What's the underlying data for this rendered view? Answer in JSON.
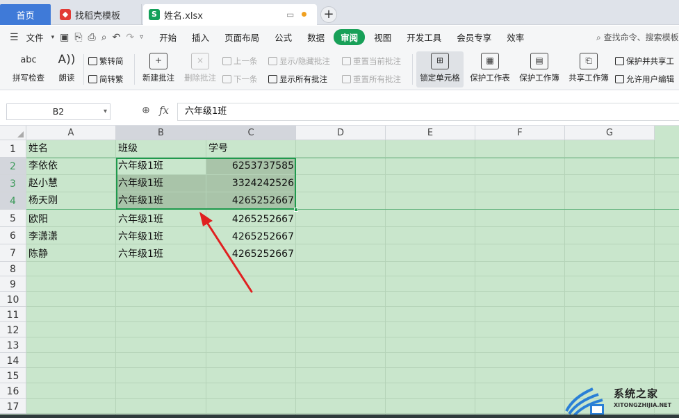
{
  "tabs": {
    "home": "首页",
    "template": "找稻壳模板",
    "file": "姓名.xlsx"
  },
  "menu": {
    "file_label": "文件",
    "items": [
      "开始",
      "插入",
      "页面布局",
      "公式",
      "数据",
      "审阅",
      "视图",
      "开发工具",
      "会员专享",
      "效率"
    ],
    "active": "审阅",
    "search_placeholder": "查找命令、搜索模板"
  },
  "ribbon": {
    "spell": "拼写检查",
    "read": "朗读",
    "trad": "繁转简",
    "simp": "简转繁",
    "new_comment": "新建批注",
    "delete_comment": "删除批注",
    "prev": "上一条",
    "next": "下一条",
    "show_hide": "显示/隐藏批注",
    "show_all": "显示所有批注",
    "reset_current": "重置当前批注",
    "reset_all": "重置所有批注",
    "lock_cell": "锁定单元格",
    "protect_sheet": "保护工作表",
    "protect_book": "保护工作簿",
    "share_book": "共享工作簿",
    "protect_share": "保护并共享工",
    "allow_edit": "允许用户编辑"
  },
  "formula": {
    "name_box": "B2",
    "fx": "fx",
    "value": "六年级1班"
  },
  "columns": [
    "A",
    "B",
    "C",
    "D",
    "E",
    "F",
    "G"
  ],
  "rows": [
    "1",
    "2",
    "3",
    "4",
    "5",
    "6",
    "7",
    "8",
    "9",
    "10",
    "11",
    "12",
    "13",
    "14",
    "15",
    "16",
    "17"
  ],
  "table": {
    "headers": [
      "姓名",
      "班级",
      "学号"
    ],
    "data": [
      [
        "李依依",
        "六年级1班",
        "6253737585"
      ],
      [
        "赵小慧",
        "六年级1班",
        "3324242526"
      ],
      [
        "杨天刚",
        "六年级1班",
        "4265252667"
      ],
      [
        "欧阳",
        "六年级1班",
        "4265252667"
      ],
      [
        "李潇潇",
        "六年级1班",
        "4265252667"
      ],
      [
        "陈静",
        "六年级1班",
        "4265252667"
      ]
    ]
  },
  "selection": {
    "range": "B2:C4"
  },
  "watermark": {
    "title": "系统之家",
    "url": "XITONGZHIJIA.NET"
  },
  "colors": {
    "accent": "#18a058",
    "home_tab": "#3f7ad8",
    "grid_bg": "#c9e6cc",
    "arrow": "#e02020"
  }
}
